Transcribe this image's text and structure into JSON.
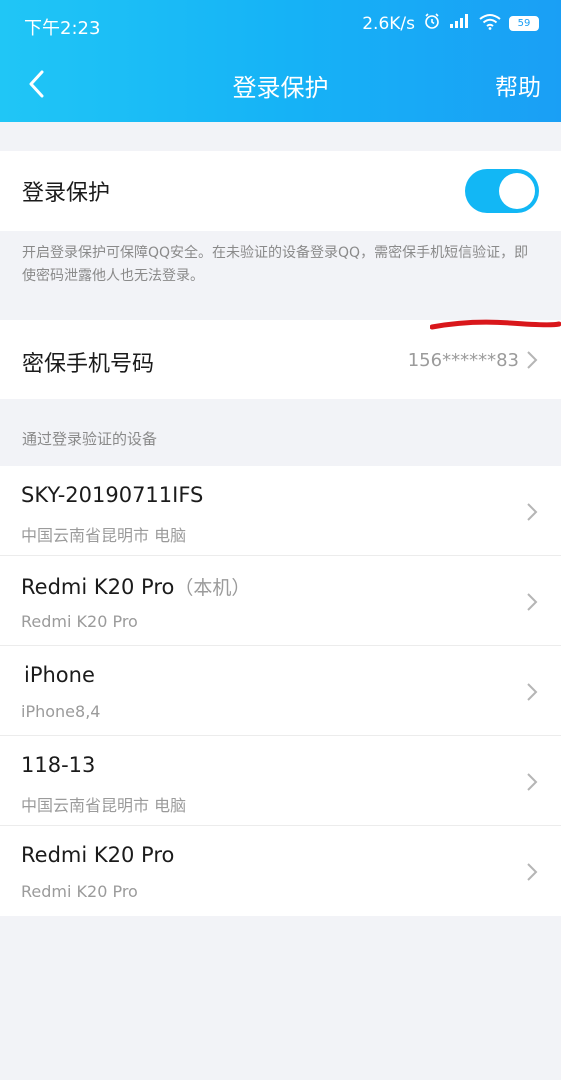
{
  "status": {
    "time": "下午2:23",
    "net_speed": "2.6K/s",
    "battery": "59"
  },
  "nav": {
    "title": "登录保护",
    "help": "帮助"
  },
  "protection": {
    "label": "登录保护",
    "enabled": true,
    "description": "开启登录保护可保障QQ安全。在未验证的设备登录QQ，需密保手机短信验证，即使密码泄露他人也无法登录。"
  },
  "phone": {
    "label": "密保手机号码",
    "value": "156******83"
  },
  "devices_section": {
    "title": "通过登录验证的设备",
    "items": [
      {
        "name": "SKY-20190711IFS",
        "note": "",
        "sub": "中国云南省昆明市 电脑"
      },
      {
        "name": "Redmi K20 Pro",
        "note": "（本机）",
        "sub": "Redmi K20 Pro"
      },
      {
        "name": "iPhone",
        "note": "",
        "sub": "iPhone8,4"
      },
      {
        "name": "118-13",
        "note": "",
        "sub": "中国云南省昆明市 电脑"
      },
      {
        "name": "Redmi K20 Pro",
        "note": "",
        "sub": "Redmi K20 Pro"
      }
    ]
  },
  "colors": {
    "accent": "#12b7f5",
    "header_start": "#20c6f6",
    "header_end": "#1a9ff5",
    "redaction_mark": "#d9171b"
  }
}
